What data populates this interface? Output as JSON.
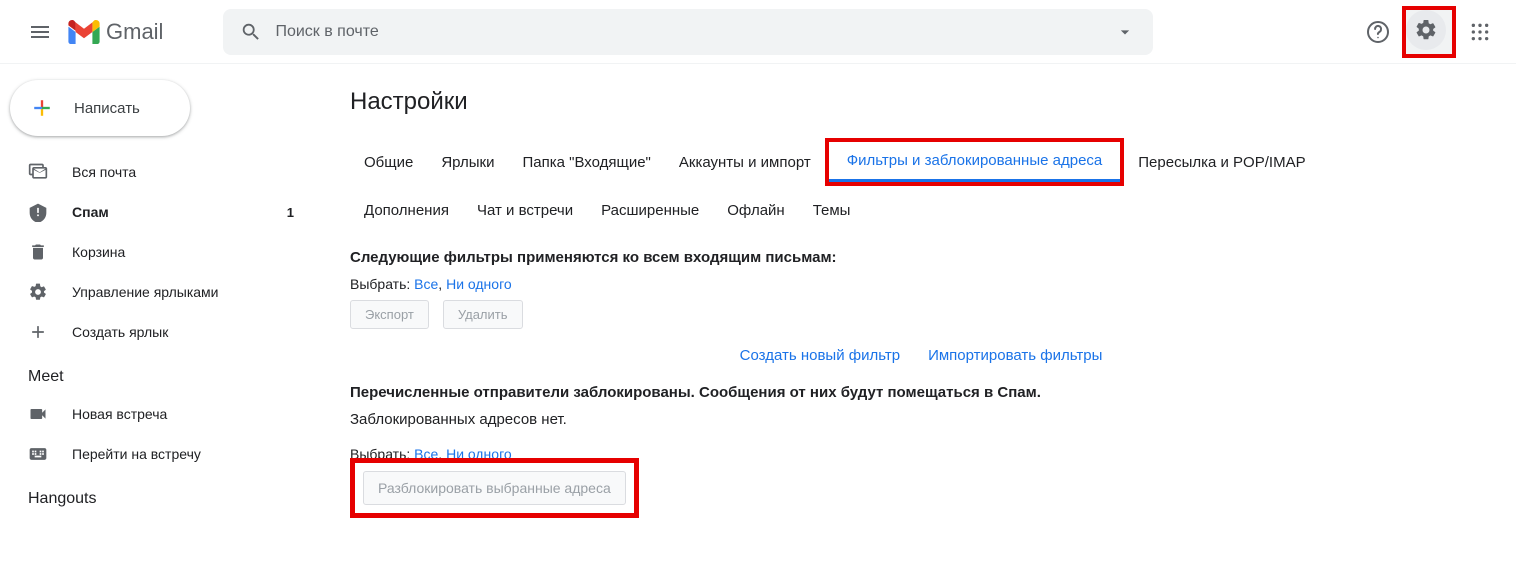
{
  "header": {
    "brand": "Gmail",
    "search_placeholder": "Поиск в почте"
  },
  "compose_label": "Написать",
  "sidebar": {
    "items": [
      {
        "label": "Вся почта",
        "badge": ""
      },
      {
        "label": "Спам",
        "badge": "1"
      },
      {
        "label": "Корзина",
        "badge": ""
      },
      {
        "label": "Управление ярлыками",
        "badge": ""
      },
      {
        "label": "Создать ярлык",
        "badge": ""
      }
    ]
  },
  "meet": {
    "title": "Meet",
    "new": "Новая встреча",
    "join": "Перейти на встречу"
  },
  "hangouts_title": "Hangouts",
  "settings": {
    "title": "Настройки",
    "tabs_row1": [
      "Общие",
      "Ярлыки",
      "Папка \"Входящие\"",
      "Аккаунты и импорт",
      "Фильтры и заблокированные адреса",
      "Пересылка и POP/IMAP"
    ],
    "tabs_row2": [
      "Дополнения",
      "Чат и встречи",
      "Расширенные",
      "Офлайн",
      "Темы"
    ],
    "active_tab_index": 4,
    "filters_heading": "Следующие фильтры применяются ко всем входящим письмам:",
    "select_label": "Выбрать:",
    "select_all": "Все",
    "select_separator": ",",
    "select_none": "Ни одного",
    "export_btn": "Экспорт",
    "delete_btn": "Удалить",
    "create_filter": "Создать новый фильтр",
    "import_filters": "Импортировать фильтры",
    "blocked_heading": "Перечисленные отправители заблокированы. Сообщения от них будут помещаться в Спам.",
    "no_blocked": "Заблокированных адресов нет.",
    "unblock_btn": "Разблокировать выбранные адреса"
  }
}
